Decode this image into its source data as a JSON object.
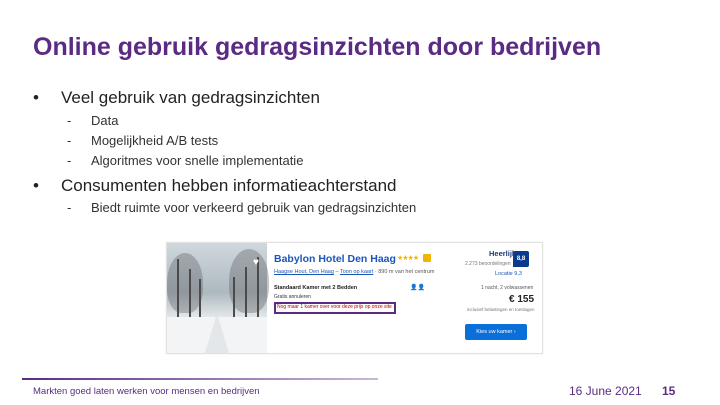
{
  "slide": {
    "title": "Online gebruik gedragsinzichten door bedrijven",
    "bullets": [
      {
        "marker": "•",
        "text": "Veel gebruik van gedragsinzichten",
        "sub": [
          {
            "marker": "-",
            "text": "Data"
          },
          {
            "marker": "-",
            "text": "Mogelijkheid A/B tests"
          },
          {
            "marker": "-",
            "text": "Algoritmes voor snelle implementatie"
          }
        ]
      },
      {
        "marker": "•",
        "text": "Consumenten hebben informatieachterstand",
        "sub": [
          {
            "marker": "-",
            "text": "Biedt ruimte voor verkeerd gebruik van gedragsinzichten"
          }
        ]
      }
    ]
  },
  "listing": {
    "hotel_name": "Babylon Hotel Den Haag",
    "stars": "★★★★",
    "location_city": "Haagse Hout, Den Haag",
    "location_map": "Toon op kaart",
    "location_distance": "890 m van het centrum",
    "room_label": "Standaard Kamer met 2 Bedden",
    "occupancy_icon": "person-icon",
    "free_cancel": "Gratis annuleren",
    "availability_alert": "Nog maar 1 kamer over voor deze prijs op onze site",
    "score_word": "Heerlijk",
    "score_reviews": "2.273 beoordelingen",
    "score_value": "8,8",
    "location_score": "Locatie 9,3",
    "stay_info": "1 nacht, 2 volwassenen",
    "price": "€ 155",
    "taxes": "inclusief belastingen en toeslagen",
    "cta_label": "Kies uw kamer ›"
  },
  "footer": {
    "tagline": "Markten goed laten werken voor mensen en bedrijven",
    "date": "16 June 2021",
    "page_number": "15"
  },
  "colors": {
    "brand": "#5b2b83",
    "link": "#1a56b8",
    "cta": "#0a6fd8",
    "alert": "#c00000"
  }
}
